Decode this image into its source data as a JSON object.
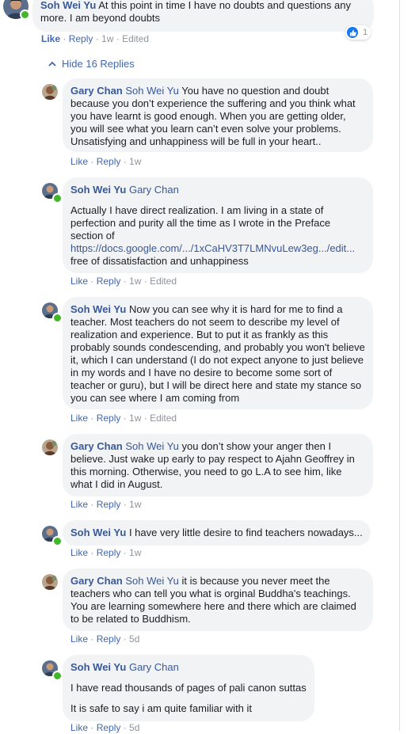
{
  "top_comment": {
    "author": "Soh Wei Yu",
    "text": "At this point in time I have no doubts and questions any more. I am beyond doubts",
    "reaction_count": "1",
    "actions": {
      "like": "Like",
      "reply": "Reply",
      "time": "1w",
      "edited": "Edited"
    }
  },
  "hide_replies_label": "Hide 16 Replies",
  "replies": [
    {
      "author": "Gary Chan",
      "tag": "Soh Wei Yu",
      "text": "You have no question and doubt because you don’t experience the suffering and you think what you have learnt is good enough. When you are getting older, you will see what you learn can’t even solve your problems. Unsatisfying and unhappiness will be full in your heart..",
      "actions": {
        "like": "Like",
        "reply": "Reply",
        "time": "1w"
      }
    },
    {
      "author": "Soh Wei Yu",
      "tag": "Gary Chan",
      "para1": "Actually I have direct realization. I am living in a state of perfection and purity all the time as I wrote in the Preface section of",
      "link": "https://docs.google.com/.../1xCaHV3T7LMNvuLew3eg.../edit...",
      "para1_end": "free of dissatisfaction and unhappiness",
      "actions": {
        "like": "Like",
        "reply": "Reply",
        "time": "1w",
        "edited": "Edited"
      }
    },
    {
      "author": "Soh Wei Yu",
      "text": "Now you can see why it is hard for me to find a teacher. Most teachers do not seem to describe my level of realization and experience. But to put it as frankly as this probably sounds condescending, and probably you won't believe it, which I can understand (I do not expect anyone to just believe in my words and I have no desire to become some sort of teacher or guru), but I will be direct here and state my stance so you can see where I am coming from",
      "actions": {
        "like": "Like",
        "reply": "Reply",
        "time": "1w",
        "edited": "Edited"
      }
    },
    {
      "author": "Gary Chan",
      "tag": "Soh Wei Yu",
      "text": "you don’t show your anger then I believe. Just wake up early to pay respect to Ajahn Geoffrey in this morning. Otherwise, you need to go L.A to see him, like what I did in August.",
      "actions": {
        "like": "Like",
        "reply": "Reply",
        "time": "1w"
      }
    },
    {
      "author": "Soh Wei Yu",
      "text": "I have very little desire to find teachers nowadays...",
      "actions": {
        "like": "Like",
        "reply": "Reply",
        "time": "1w"
      }
    },
    {
      "author": "Gary Chan",
      "tag": "Soh Wei Yu",
      "text": "it is because you never meet the teachers who can tell you what is orginal Buddha's teachings. You are learning somewhere here and there which are claimed to be related to Buddhism.",
      "actions": {
        "like": "Like",
        "reply": "Reply",
        "time": "5d"
      }
    },
    {
      "author": "Soh Wei Yu",
      "tag": "Gary Chan",
      "para1": "I have read thousands of pages of pali canon suttas",
      "para2": "It is safe to say i am quite familiar with it",
      "actions": {
        "like": "Like",
        "reply": "Reply",
        "time": "5d"
      }
    }
  ],
  "colors": {
    "link_blue": "#385898",
    "action_blue": "#4267b2",
    "bubble_bg": "#f2f3f5",
    "online_green": "#42b72a",
    "meta_gray": "#90949c"
  },
  "icons": [
    "like-reaction-icon",
    "chevron-up-icon",
    "online-status-icon"
  ]
}
